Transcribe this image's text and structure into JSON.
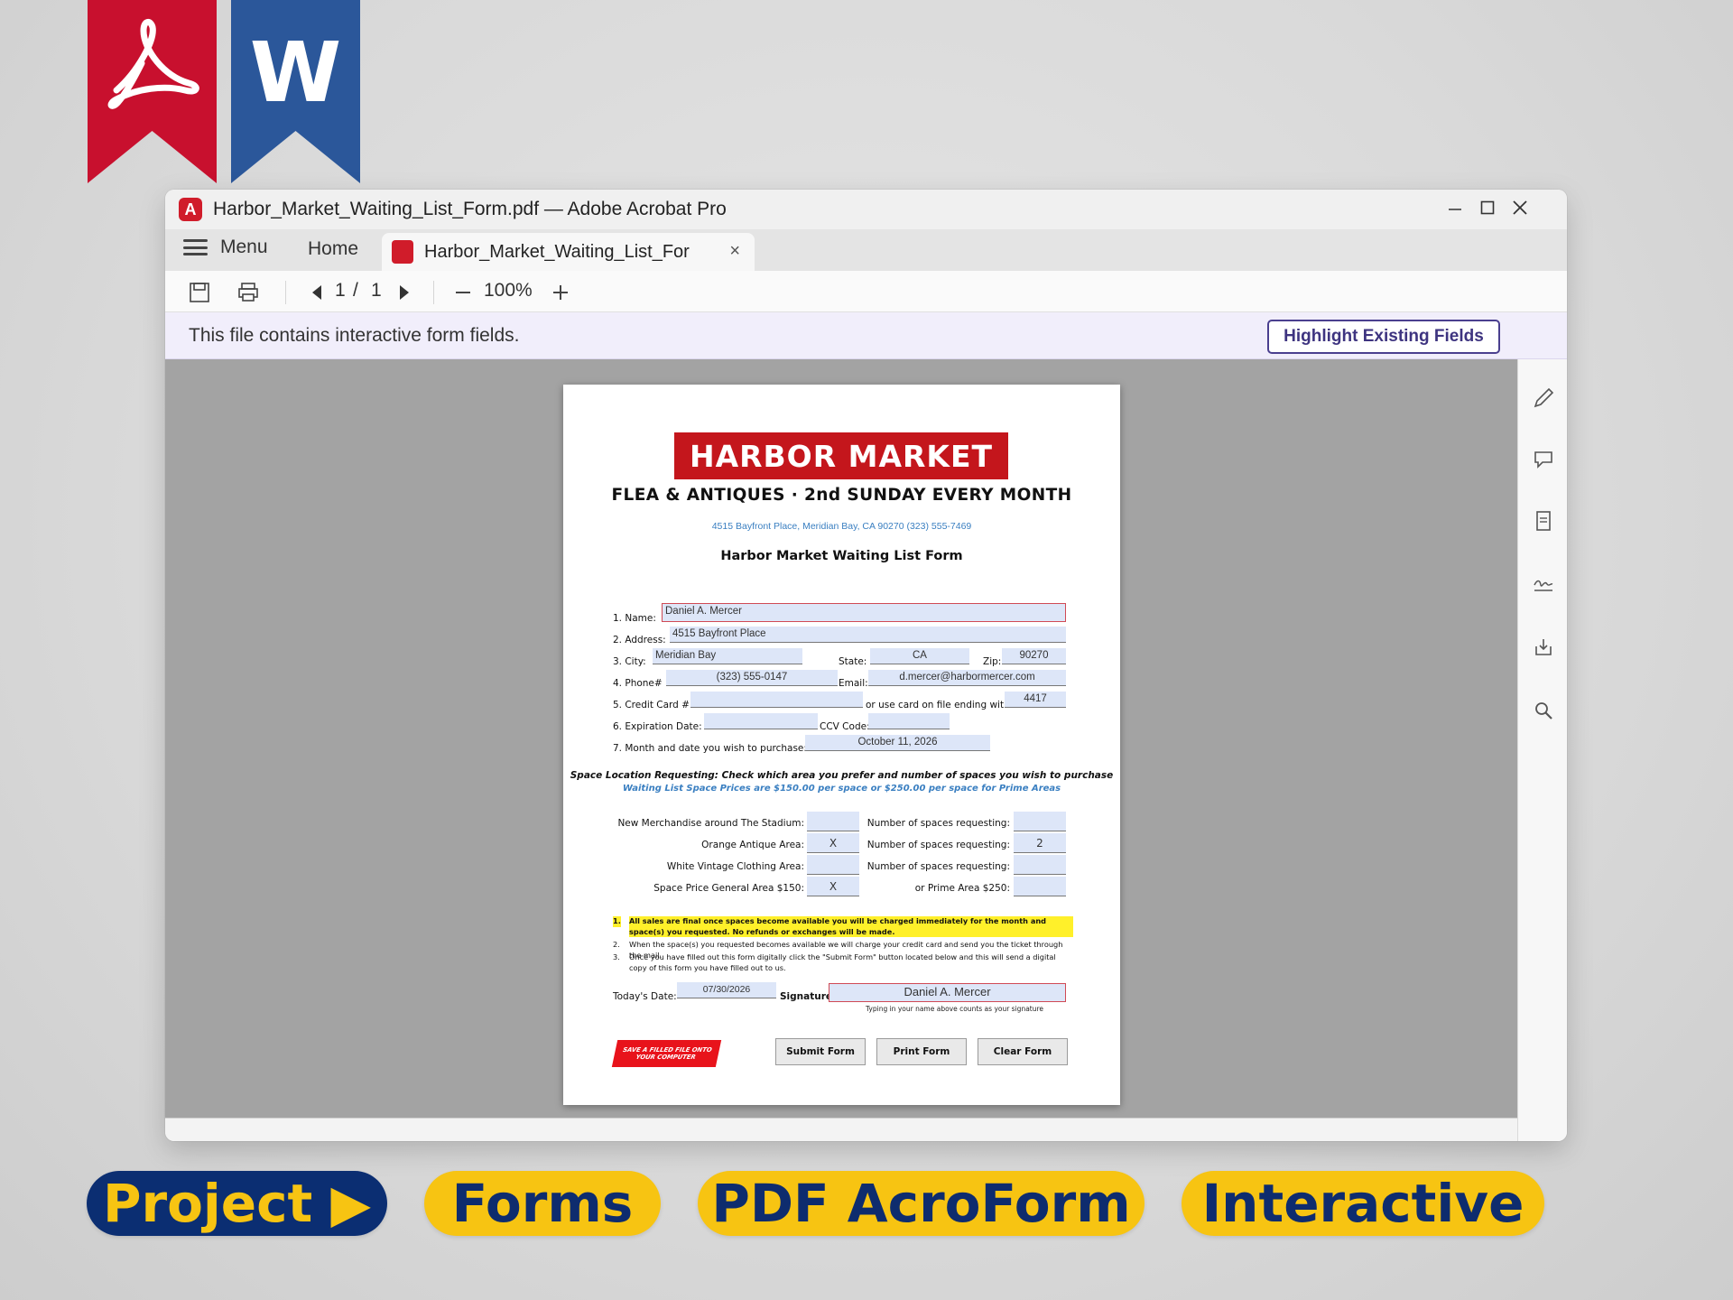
{
  "colors": {
    "acrobat_red": "#c8102e",
    "word_blue": "#2b579a",
    "banner_red": "#c4161c",
    "pill_yellow": "#f7c412",
    "pill_navy": "#0b2e72",
    "info_bar": "#f1eefb"
  },
  "ribbons": {
    "acrobat_icon": "acrobat-swirl-icon",
    "word_letter": "W"
  },
  "window": {
    "title": "Harbor_Market_Waiting_List_Form.pdf — Adobe Acrobat Pro",
    "app_icon_letter": "A",
    "controls": {
      "minimize": "—",
      "maximize": "☐",
      "close": "✕"
    }
  },
  "tabs": {
    "menu_label": "Menu",
    "home_label": "Home",
    "doc_tab_label": "Harbor_Market_Waiting_List_For",
    "close_glyph": "×"
  },
  "toolbar": {
    "current_page": "1",
    "page_separator": "/",
    "total_pages": "1",
    "zoom": "100%",
    "zoom_out": "—",
    "zoom_in": "+"
  },
  "infobar": {
    "message": "This file contains interactive form fields.",
    "button": "Highlight Existing Fields"
  },
  "right_panel_icons": [
    "pen-icon",
    "comment-icon",
    "page-icon",
    "signature-icon",
    "export-icon",
    "search-icon"
  ],
  "form": {
    "banner": "HARBOR MARKET",
    "subhead": "FLEA & ANTIQUES  ·  2nd SUNDAY EVERY MONTH",
    "address_line": "4515 Bayfront Place, Meridian Bay, CA 90270  (323) 555-7469",
    "title": "Harbor Market Waiting List Form",
    "labels": {
      "name": "1.   Name:",
      "address": "2.   Address:",
      "city": "3.   City:",
      "state": "State:",
      "zip": "Zip:",
      "phone": "4.   Phone#",
      "email": "Email:",
      "card": "5.   Credit Card #",
      "card_on_file": "or use card on file ending with",
      "expiration": "6.   Expiration Date:",
      "ccv": "CCV Code:",
      "month": "7.   Month and date you wish to purchase:"
    },
    "values": {
      "name": "Daniel A. Mercer",
      "address": "4515 Bayfront Place",
      "city": "Meridian Bay",
      "state": "CA",
      "zip": "90270",
      "phone": "(323) 555-0147",
      "email": "d.mercer@harbormercer.com",
      "card": "",
      "card_on_file": "4417",
      "expiration": "",
      "ccv": "",
      "month": "October 11, 2026"
    },
    "space_heading": "Space Location Requesting: Check which area you prefer and number of spaces you wish to purchase",
    "space_prices": "Waiting List Space Prices are $150.00 per space or $250.00 per space for Prime Areas",
    "space_rows": [
      {
        "area": "New Merchandise around The Stadium:",
        "mark": "",
        "count_label": "Number of spaces requesting:",
        "count": ""
      },
      {
        "area": "Orange Antique Area:",
        "mark": "X",
        "count_label": "Number of spaces requesting:",
        "count": "2"
      },
      {
        "area": "White Vintage Clothing Area:",
        "mark": "",
        "count_label": "Number of spaces requesting:",
        "count": ""
      },
      {
        "area": "Space Price General Area $150:",
        "mark": "X",
        "count_label": "or Prime Area $250:",
        "count": ""
      }
    ],
    "notes": [
      {
        "n": "1.",
        "text": "All sales are final once spaces become available you will be charged immediately for the month and space(s) you requested. No refunds or exchanges will be made."
      },
      {
        "n": "2.",
        "text": "When the space(s) you requested becomes available we will charge your credit card and send you the ticket through the mail."
      },
      {
        "n": "3.",
        "text": "Once you have filled out this form digitally click the \"Submit Form\" button located below and this will send a digital copy of this form you have filled out to us."
      }
    ],
    "todays_date_label": "Today's Date:",
    "todays_date": "07/30/2026",
    "signature_label": "Signature:",
    "signature": "Daniel A. Mercer",
    "signature_hint": "Typing in your name above counts as your signature",
    "save_badge": "SAVE A FILLED FILE ONTO YOUR COMPUTER",
    "buttons": {
      "submit": "Submit Form",
      "print": "Print Form",
      "clear": "Clear Form"
    }
  },
  "pills": [
    "Project ▶",
    "Forms",
    "PDF AcroForm",
    "Interactive"
  ]
}
